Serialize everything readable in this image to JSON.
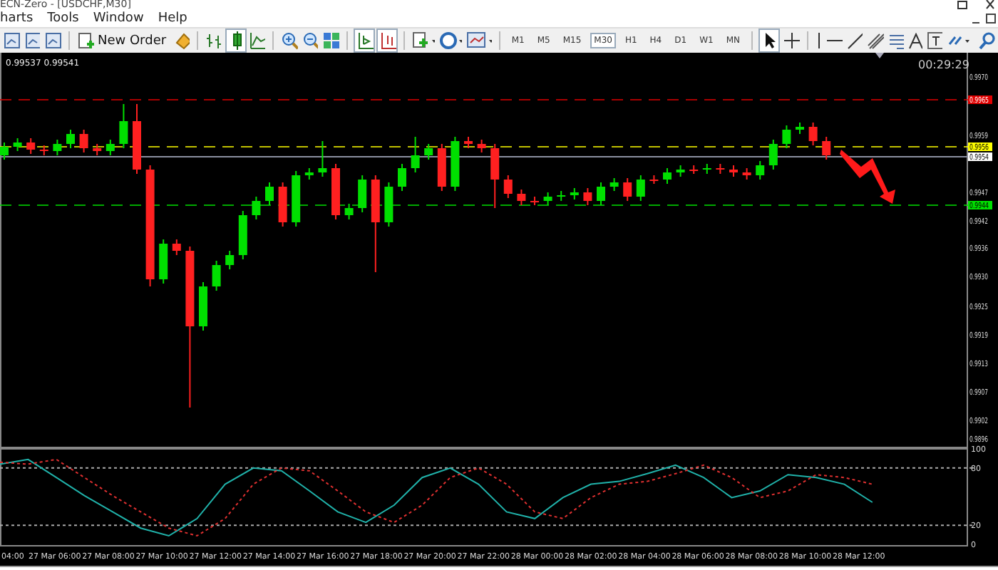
{
  "window": {
    "title": "ECN-Zero - [USDCHF,M30]"
  },
  "menu": [
    {
      "label": "harts"
    },
    {
      "label": "Tools"
    },
    {
      "label": "Window"
    },
    {
      "label": "Help"
    }
  ],
  "toolbar": {
    "new_order": "New Order",
    "timeframes": [
      {
        "label": "M1",
        "selected": false
      },
      {
        "label": "M5",
        "selected": false
      },
      {
        "label": "M15",
        "selected": false
      },
      {
        "label": "M30",
        "selected": true
      },
      {
        "label": "H1",
        "selected": false
      },
      {
        "label": "H4",
        "selected": false
      },
      {
        "label": "D1",
        "selected": false
      },
      {
        "label": "W1",
        "selected": false
      },
      {
        "label": "MN",
        "selected": false
      }
    ]
  },
  "chart": {
    "quote": "0.99537 0.99541",
    "timer": "00:29:29",
    "price_ticks": [
      "0.9970",
      "0.9959",
      "0.9947",
      "0.9942",
      "0.9936",
      "0.9930",
      "0.9925",
      "0.9919",
      "0.9913",
      "0.9907",
      "0.9902",
      "0.9896"
    ],
    "price_markers": [
      {
        "text": "0.9965",
        "color": "#e00000"
      },
      {
        "text": "0.9956",
        "color": "#ffff00"
      },
      {
        "text": "0.9954",
        "color": "#ffffff"
      },
      {
        "text": "0.9944",
        "color": "#00e000"
      }
    ],
    "indicator": {
      "chart_data": {
        "type": "line",
        "ylim": [
          0,
          100
        ],
        "yticks": [
          100,
          80,
          20,
          0
        ],
        "series": [
          {
            "color": "#20b2aa",
            "line_style": "solid",
            "values": [
              84,
              89,
              70,
              51,
              34,
              17,
              9,
              27,
              63,
              80,
              77,
              56,
              34,
              23,
              41,
              70,
              80,
              63,
              34,
              27,
              49,
              63,
              66,
              74,
              83,
              70,
              49,
              56,
              73,
              70,
              63,
              44
            ]
          },
          {
            "color": "#e03030",
            "line_style": "dashed",
            "values": [
              86,
              84,
              89,
              70,
              51,
              34,
              17,
              9,
              27,
              63,
              80,
              77,
              56,
              34,
              23,
              41,
              70,
              80,
              63,
              34,
              27,
              49,
              63,
              66,
              74,
              83,
              70,
              49,
              56,
              73,
              70,
              63
            ]
          }
        ]
      }
    },
    "time_labels": [
      "04:00",
      "27 Mar 06:00",
      "27 Mar 08:00",
      "27 Mar 10:00",
      "27 Mar 12:00",
      "27 Mar 14:00",
      "27 Mar 16:00",
      "27 Mar 18:00",
      "27 Mar 20:00",
      "27 Mar 22:00",
      "28 Mar 00:00",
      "28 Mar 02:00",
      "28 Mar 04:00",
      "28 Mar 06:00",
      "28 Mar 08:00",
      "28 Mar 10:00",
      "28 Mar 12:00"
    ]
  }
}
